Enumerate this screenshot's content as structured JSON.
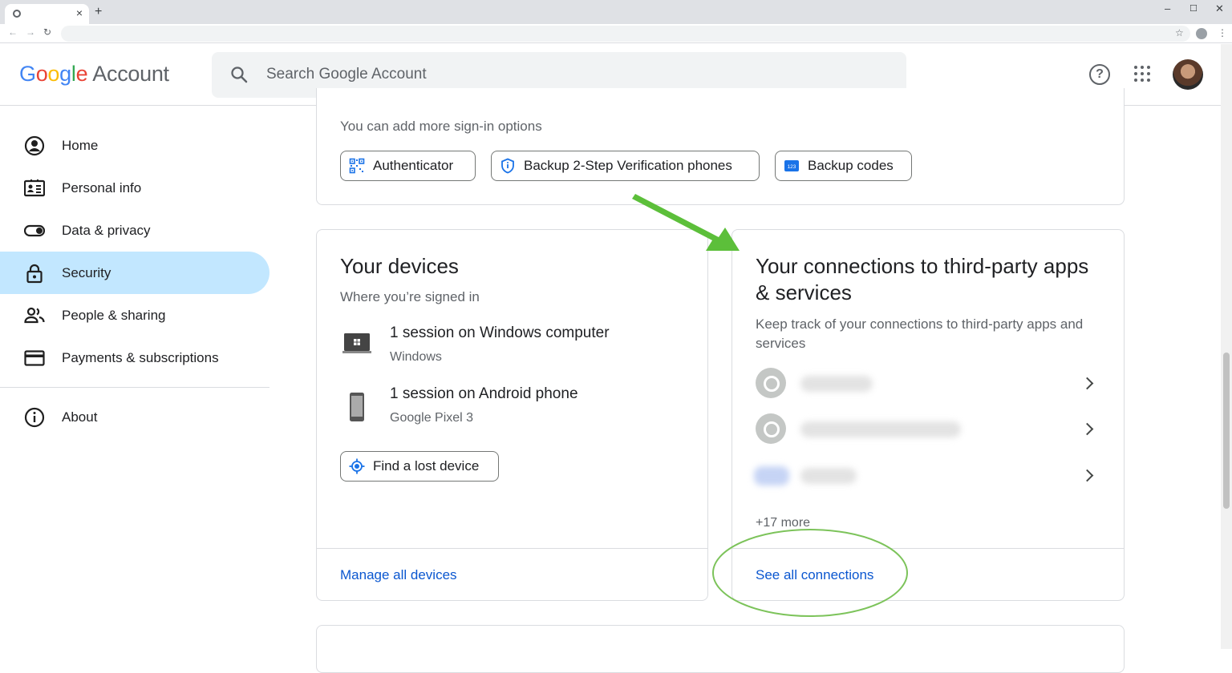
{
  "browser": {
    "tab_close": "×",
    "new_tab": "+",
    "window_controls": [
      "–",
      "☐",
      "✕"
    ]
  },
  "header": {
    "logo_letters": [
      "G",
      "o",
      "o",
      "g",
      "l",
      "e"
    ],
    "logo_suffix": "Account",
    "search_placeholder": "Search Google Account",
    "help_glyph": "?"
  },
  "sidebar": {
    "items": [
      {
        "label": "Home",
        "icon": "account-circle-icon",
        "active": false
      },
      {
        "label": "Personal info",
        "icon": "id-card-icon",
        "active": false
      },
      {
        "label": "Data & privacy",
        "icon": "toggle-icon",
        "active": false
      },
      {
        "label": "Security",
        "icon": "lock-icon",
        "active": true
      },
      {
        "label": "People & sharing",
        "icon": "people-icon",
        "active": false
      },
      {
        "label": "Payments & subscriptions",
        "icon": "credit-card-icon",
        "active": false
      }
    ],
    "about": {
      "label": "About",
      "icon": "info-icon"
    }
  },
  "signin_card": {
    "hint": "You can add more sign-in options",
    "chips": [
      {
        "label": "Authenticator",
        "icon": "qr-authenticator-icon"
      },
      {
        "label": "Backup 2-Step Verification phones",
        "icon": "shield-icon"
      },
      {
        "label": "Backup codes",
        "icon": "backup-codes-icon"
      }
    ]
  },
  "devices_card": {
    "title": "Your devices",
    "subtitle": "Where you’re signed in",
    "sessions": [
      {
        "title": "1 session on Windows computer",
        "detail": "Windows",
        "icon": "laptop-icon"
      },
      {
        "title": "1 session on Android phone",
        "detail": "Google Pixel 3",
        "icon": "phone-icon"
      }
    ],
    "find_button": "Find a lost device",
    "footer_link": "Manage all devices"
  },
  "connections_card": {
    "title": "Your connections to third-party apps & services",
    "description": "Keep track of your connections to third-party apps and services",
    "more_count": "+17 more",
    "footer_link": "See all connections"
  },
  "annotations": {
    "arrow_color": "#5cbf3a",
    "circle_color": "#7cc35a"
  }
}
